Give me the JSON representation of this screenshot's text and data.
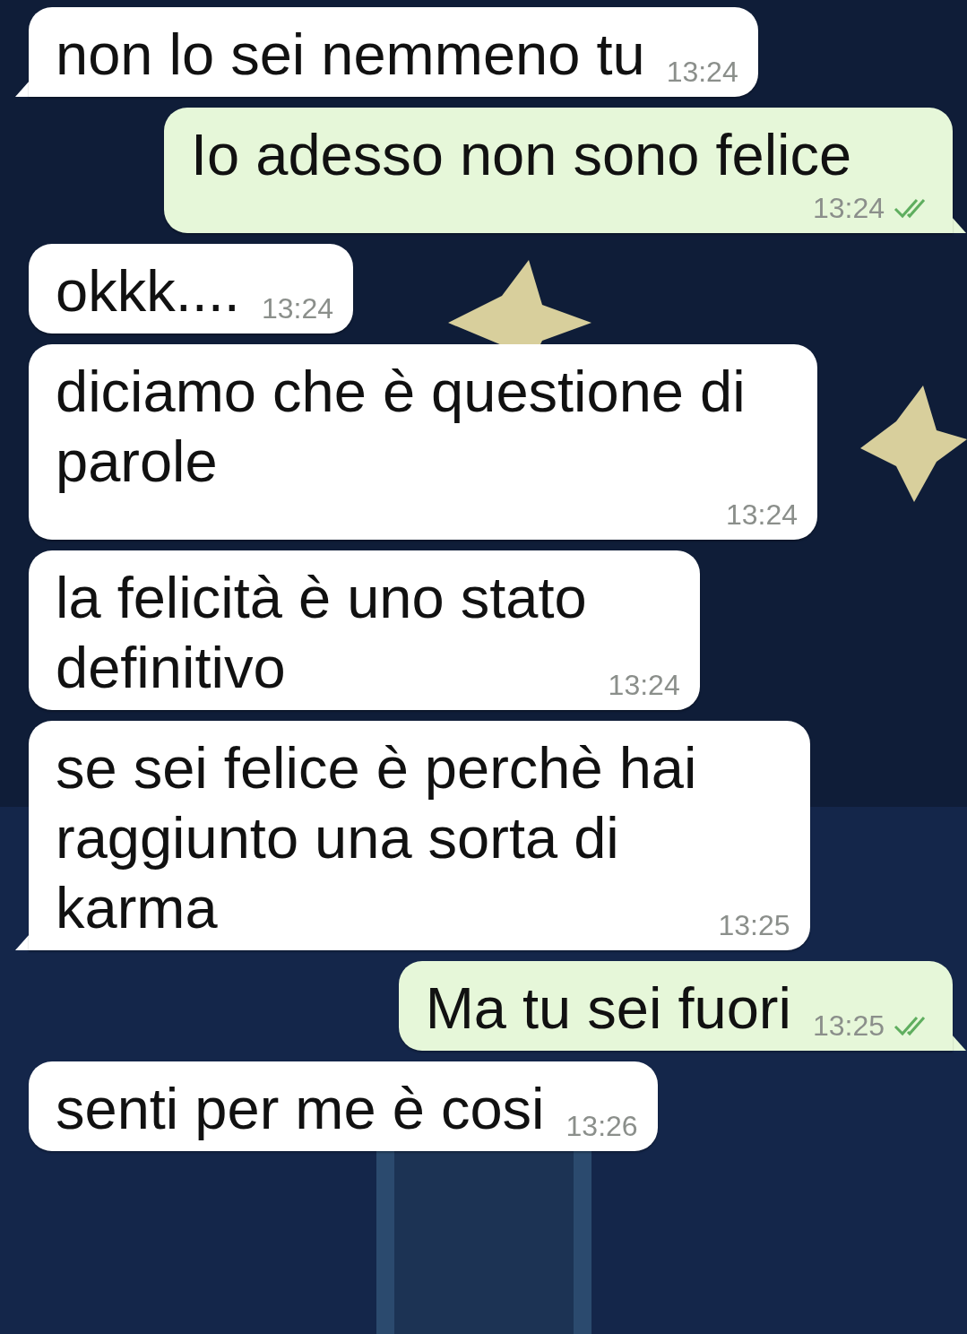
{
  "messages": [
    {
      "kind": "received",
      "text": "non lo sei nemmeno tu",
      "time": "13:24",
      "tail": true
    },
    {
      "kind": "sent",
      "text": "Io adesso non sono felice",
      "time": "13:24",
      "read": true,
      "tail": true
    },
    {
      "kind": "received",
      "text": "okkk....",
      "time": "13:24",
      "tail": false
    },
    {
      "kind": "received",
      "text": "diciamo che è questione di\nparole",
      "time": "13:24",
      "tail": false
    },
    {
      "kind": "received",
      "text": "la felicità è uno stato\ndefinitivo",
      "time": "13:24",
      "tail": false
    },
    {
      "kind": "received",
      "text": "se sei felice è perchè hai\nraggiunto una sorta di\nkarma",
      "time": "13:25",
      "tail": true
    },
    {
      "kind": "sent",
      "text": "Ma tu sei fuori",
      "time": "13:25",
      "read": true,
      "tail": true
    },
    {
      "kind": "received",
      "text": "senti per me è cosi",
      "time": "13:26",
      "tail": false
    }
  ]
}
